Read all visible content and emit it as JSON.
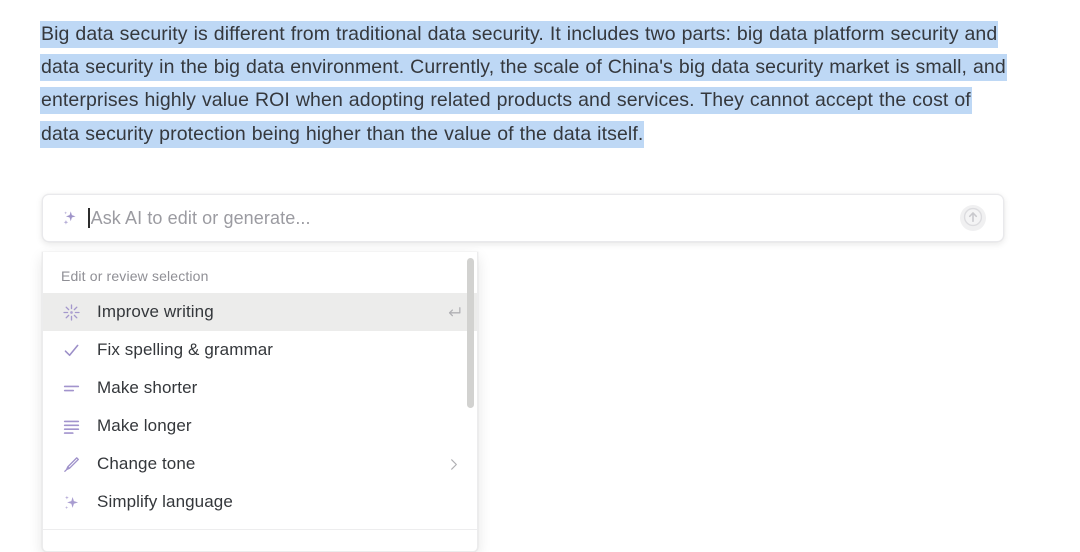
{
  "document": {
    "selected_paragraph": "Big data security is different from traditional data security. It includes two parts: big data platform security and data security in the big data environment. Currently, the scale of China's big data security market is small, and enterprises highly value ROI when adopting related products and services. They cannot accept the cost of data security protection being higher than the value of the data itself.",
    "selection_highlight_color": "#bed8f5"
  },
  "ai_bar": {
    "placeholder": "Ask AI to edit or generate...",
    "value": "",
    "leading_icon": "sparkle-icon",
    "submit_icon": "arrow-up-circle-icon"
  },
  "menu": {
    "header": "Edit or review selection",
    "accent_color": "#9b8ec4",
    "items": [
      {
        "label": "Improve writing",
        "icon": "sparkle-burst-icon",
        "accessory": "return-key-icon",
        "accessory_glyph": "↵",
        "active": true
      },
      {
        "label": "Fix spelling & grammar",
        "icon": "check-icon",
        "accessory": "",
        "accessory_glyph": "",
        "active": false
      },
      {
        "label": "Make shorter",
        "icon": "shorten-lines-icon",
        "accessory": "",
        "accessory_glyph": "",
        "active": false
      },
      {
        "label": "Make longer",
        "icon": "lengthen-lines-icon",
        "accessory": "",
        "accessory_glyph": "",
        "active": false
      },
      {
        "label": "Change tone",
        "icon": "pen-icon",
        "accessory": "chevron-right-icon",
        "accessory_glyph": "›",
        "active": false
      },
      {
        "label": "Simplify language",
        "icon": "sparkle-icon",
        "accessory": "",
        "accessory_glyph": "",
        "active": false
      }
    ]
  }
}
